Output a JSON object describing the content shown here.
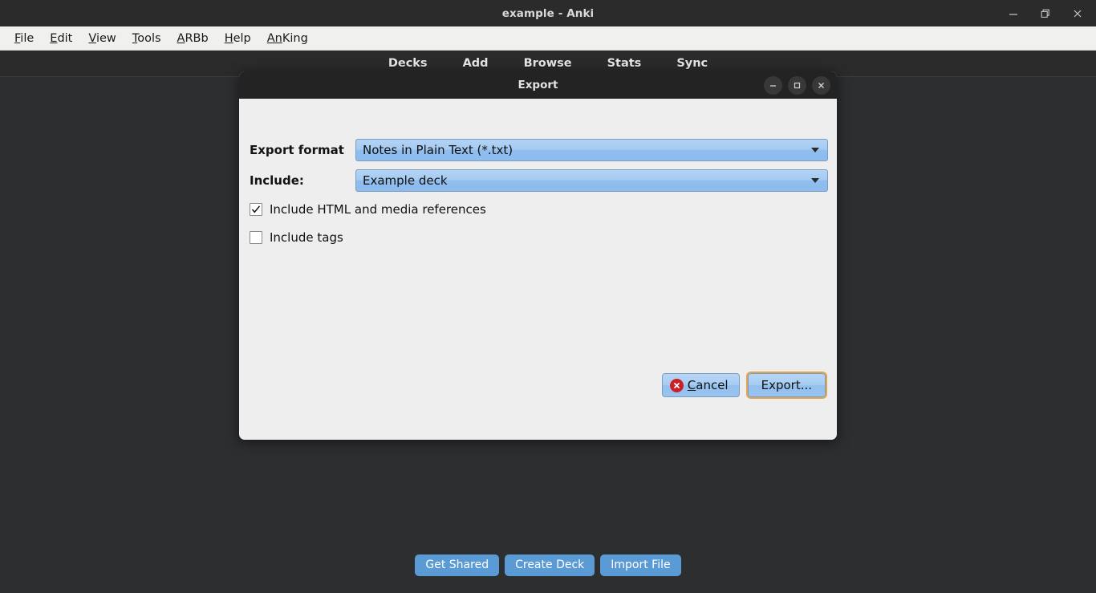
{
  "window": {
    "title": "example - Anki",
    "controls": [
      {
        "name": "minimize",
        "glyph": "minimize-icon"
      },
      {
        "name": "maximize",
        "glyph": "restore-icon"
      },
      {
        "name": "close",
        "glyph": "close-icon"
      }
    ]
  },
  "menubar": {
    "items": [
      {
        "label": "File",
        "mnemonic": "F",
        "rest": "ile"
      },
      {
        "label": "Edit",
        "mnemonic": "E",
        "rest": "dit"
      },
      {
        "label": "View",
        "mnemonic": "V",
        "rest": "iew"
      },
      {
        "label": "Tools",
        "mnemonic": "T",
        "rest": "ools"
      },
      {
        "label": "ARBb",
        "mnemonic": "A",
        "rest": "RBb"
      },
      {
        "label": "Help",
        "mnemonic": "H",
        "rest": "elp"
      },
      {
        "label": "AnKing",
        "mnemonic": "An",
        "rest": "King"
      }
    ]
  },
  "navbar": {
    "items": [
      {
        "label": "Decks"
      },
      {
        "label": "Add"
      },
      {
        "label": "Browse"
      },
      {
        "label": "Stats"
      },
      {
        "label": "Sync"
      }
    ]
  },
  "dialog": {
    "title": "Export",
    "controls": [
      {
        "name": "minimize",
        "glyph": "minimize-icon"
      },
      {
        "name": "maximize",
        "glyph": "maximize-icon"
      },
      {
        "name": "close",
        "glyph": "close-icon"
      }
    ],
    "fields": {
      "export_format": {
        "label": "Export format",
        "value": "Notes in Plain Text (*.txt)"
      },
      "include": {
        "label": "Include:",
        "value": "Example deck"
      }
    },
    "checkboxes": [
      {
        "label": "Include HTML and media references",
        "checked": true
      },
      {
        "label": "Include tags",
        "checked": false
      }
    ],
    "buttons": {
      "cancel": {
        "mnemonic": "C",
        "rest": "ancel",
        "icon": "cancel-icon"
      },
      "export": {
        "label": "Export...",
        "focused": true
      }
    }
  },
  "bottom_toolbar": {
    "buttons": [
      {
        "label": "Get Shared"
      },
      {
        "label": "Create Deck"
      },
      {
        "label": "Import File"
      }
    ]
  },
  "colors": {
    "page_background": "#2d2e30",
    "titlebar": "#2b2b2b",
    "menubar": "#f0f0ef",
    "dialog_background": "#efeeee",
    "accent_blue": "#5b9bd5",
    "combo_blue": "#a6cbf2",
    "focus_outline": "#e0a44f",
    "cancel_red": "#cc2027"
  }
}
